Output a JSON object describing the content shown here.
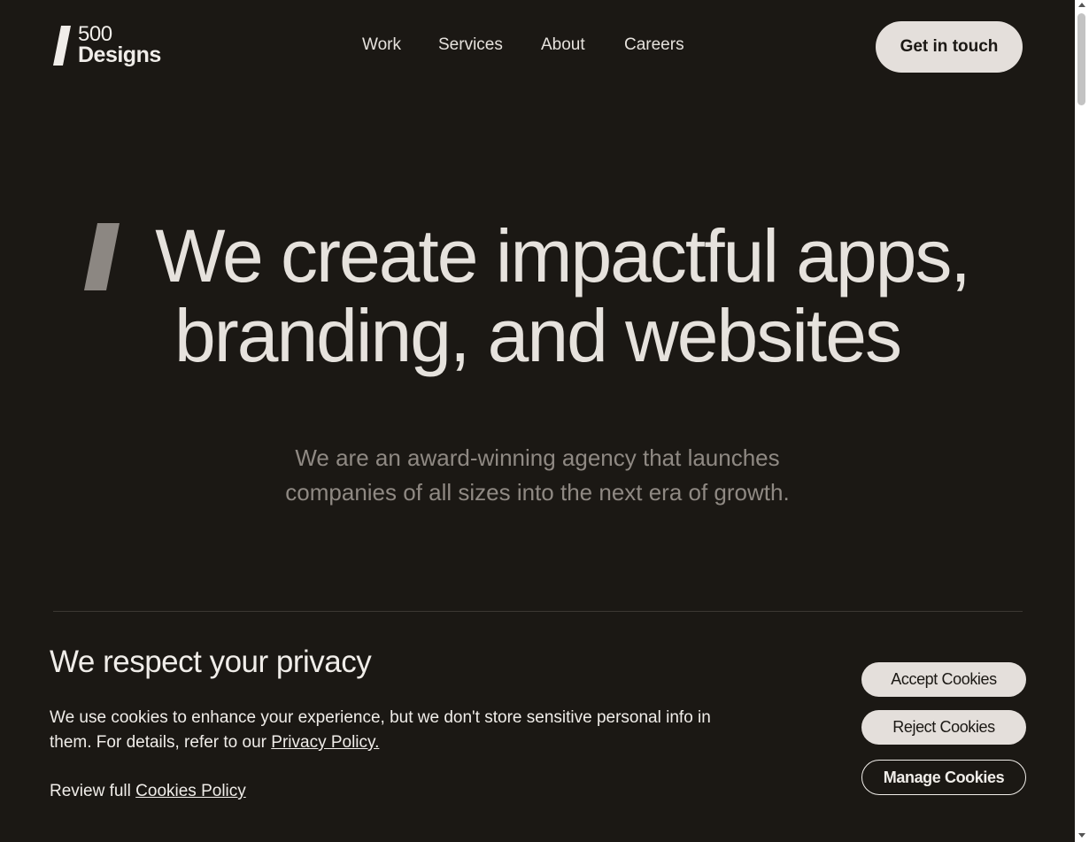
{
  "header": {
    "logo_number": "500",
    "logo_word": "Designs",
    "nav": [
      "Work",
      "Services",
      "About",
      "Careers"
    ],
    "cta": "Get in touch"
  },
  "hero": {
    "title_line1": "We create impactful apps,",
    "title_line2": "branding, and websites",
    "subtitle_line1": "We are an award-winning agency that launches",
    "subtitle_line2": "companies of all sizes into the next era of growth."
  },
  "cookie": {
    "title": "We respect your privacy",
    "text": "We use cookies to enhance your experience, but we don't store sensitive personal info in them. For details, refer to our",
    "privacy_link": "Privacy Policy.",
    "review_prefix": "Review full",
    "cookies_link": "Cookies Policy",
    "accept": "Accept Cookies",
    "reject": "Reject Cookies",
    "manage": "Manage Cookies"
  },
  "colors": {
    "background": "#1b1814",
    "text": "#e6e2dd",
    "muted_text": "#8f8983",
    "button_bg": "#e4dfdb",
    "slash_gray": "#8c8782"
  },
  "icons": [
    "slash-mark",
    "scroll-up-arrow",
    "scroll-down-arrow"
  ]
}
